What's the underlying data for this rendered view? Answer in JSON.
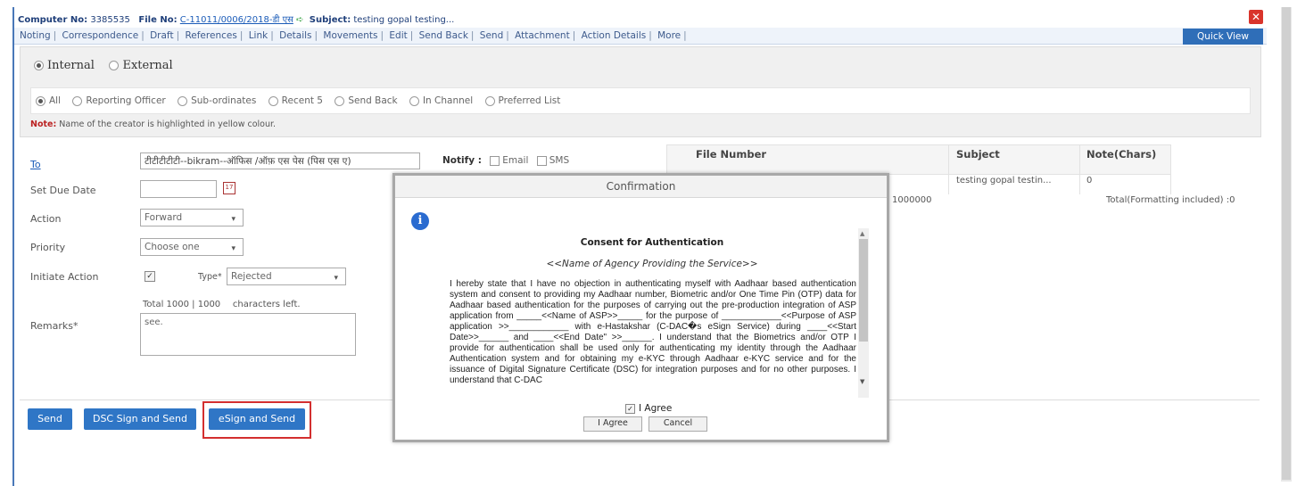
{
  "header": {
    "computer_no_label": "Computer No:",
    "computer_no": "3385535",
    "file_no_label": "File No:",
    "file_no": "C-11011/0006/2018-डी एस",
    "subject_label": "Subject:",
    "subject": "testing gopal testing..."
  },
  "menu": {
    "items": [
      "Noting",
      "Correspondence",
      "Draft",
      "References",
      "Link",
      "Details",
      "Movements",
      "Edit",
      "Send Back",
      "Send",
      "Attachment",
      "Action Details",
      "More"
    ],
    "quick_view": "Quick View"
  },
  "scope": {
    "internal": "Internal",
    "external": "External"
  },
  "filters": {
    "options": [
      "All",
      "Reporting Officer",
      "Sub-ordinates",
      "Recent 5",
      "Send Back",
      "In Channel",
      "Preferred List"
    ]
  },
  "note": {
    "prefix": "Note:",
    "text": "Name of the creator is highlighted in yellow colour."
  },
  "form": {
    "to_label": "To",
    "to_value": "टीटीटीटीटी--bikram--ऑफिस /ऑफ़ एस पेस (पिस एस ए)",
    "notify_label": "Notify :",
    "email_label": "Email",
    "sms_label": "SMS",
    "due_date_label": "Set Due Date",
    "action_label": "Action",
    "action_value": "Forward",
    "priority_label": "Priority",
    "priority_value": "Choose one",
    "initiate_label": "Initiate Action",
    "type_label": "Type*",
    "type_value": "Rejected",
    "total_text": "Total 1000 |",
    "remaining": "1000",
    "chars_left": "characters left.",
    "remarks_label": "Remarks*",
    "remarks_value": "see."
  },
  "buttons": {
    "send": "Send",
    "dsc_send": "DSC Sign and Send",
    "esign_send": "eSign and Send"
  },
  "table": {
    "headers": [
      "File Number",
      "Subject",
      "Note(Chars)"
    ],
    "row": {
      "subject": "testing gopal testin...",
      "note_chars": "0"
    },
    "count": "1000000",
    "total": "Total(Formatting included) :0"
  },
  "dialog": {
    "title": "Confirmation",
    "consent_title": "Consent for Authentication",
    "agency": "<<Name of Agency Providing the Service>>",
    "text": "I hereby state that I have no objection in authenticating myself with Aadhaar based authentication system and consent to providing my Aadhaar number, Biometric and/or One Time Pin (OTP) data for Aadhaar based authentication for the purposes of carrying out the pre-production integration of ASP application from _____<<Name of ASP>>_____ for the purpose of ____________<<Purpose of ASP application >>____________ with e-Hastakshar (C-DAC�s eSign Service) during ____<<Start Date>>______ and ____<<End Date\" >>______. I understand that the Biometrics and/or OTP I provide for authentication shall be used only for authenticating my identity through the Aadhaar Authentication system and for obtaining my e-KYC through Aadhaar e-KYC service and for the issuance of Digital Signature Certificate (DSC) for integration purposes and for no other purposes. I understand that C-DAC",
    "agree_label": "I Agree",
    "agree_button": "I Agree",
    "cancel_button": "Cancel"
  },
  "colors": {
    "accent": "#2f76c6",
    "highlight": "#d32f2f",
    "info": "#2a6bd0"
  }
}
